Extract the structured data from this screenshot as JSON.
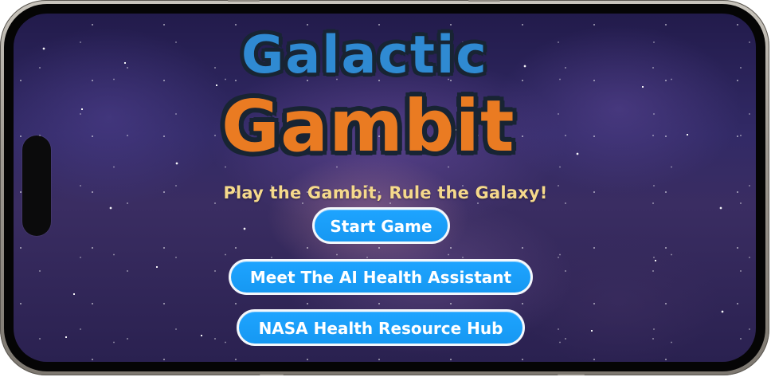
{
  "app": {
    "title_line1": "Galactic",
    "title_line2": "Gambit",
    "tagline": "Play the Gambit, Rule the Galaxy!"
  },
  "menu": {
    "start_label": "Start Game",
    "ai_label": "Meet The AI Health Assistant",
    "nasa_label": "NASA Health Resource Hub"
  },
  "colors": {
    "title_blue": "#2f8ad2",
    "title_orange": "#ea7b22",
    "outline_navy": "#182433",
    "tagline_gold": "#f5d98b",
    "button_blue": "#1ea4ff"
  },
  "icons": {
    "camera_cutout": "camera-pill-icon"
  }
}
